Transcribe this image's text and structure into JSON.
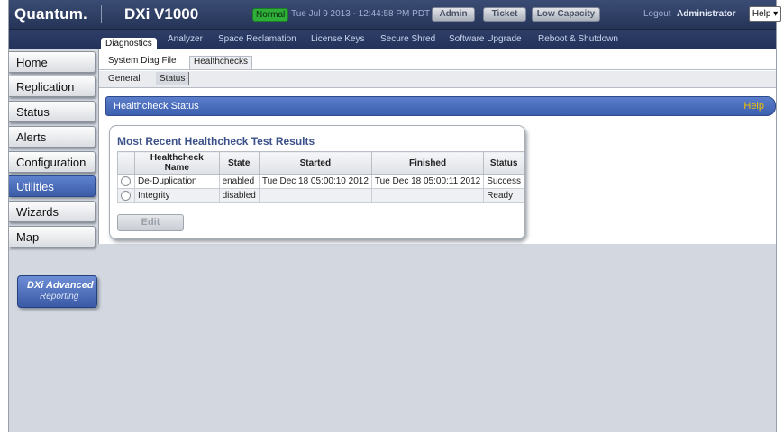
{
  "header": {
    "logo": "Quantum.",
    "product": "DXi V1000",
    "status": "Normal",
    "datetime": "Tue Jul 9 2013 - 12:44:58 PM PDT",
    "buttons": [
      "Admin",
      "Ticket",
      "Low Capacity"
    ],
    "logout": "Logout",
    "user": "Administrator",
    "help": "Help ▾"
  },
  "subnav": [
    "Diagnostics",
    "Analyzer",
    "Space Reclamation",
    "License Keys",
    "Secure Shred",
    "Software Upgrade",
    "Reboot & Shutdown"
  ],
  "tabs1": [
    "System Diag File",
    "Healthchecks"
  ],
  "tabs2": [
    "General",
    "Status"
  ],
  "section": {
    "title": "Healthcheck Status",
    "help": "Help"
  },
  "results": {
    "title": "Most Recent Healthcheck Test Results",
    "columns": [
      "Healthcheck Name",
      "State",
      "Started",
      "Finished",
      "Status"
    ],
    "rows": [
      [
        "De-Duplication",
        "enabled",
        "Tue Dec 18 05:00:10 2012",
        "Tue Dec 18 05:00:11 2012",
        "Success"
      ],
      [
        "Integrity",
        "disabled",
        "",
        "",
        "Ready"
      ]
    ],
    "edit": "Edit"
  },
  "sidebar": [
    "Home",
    "Replication",
    "Status",
    "Alerts",
    "Configuration",
    "Utilities",
    "Wizards",
    "Map"
  ],
  "reporting": {
    "line1a": "DXi",
    "line1b": "Advanced",
    "line2": "Reporting"
  }
}
